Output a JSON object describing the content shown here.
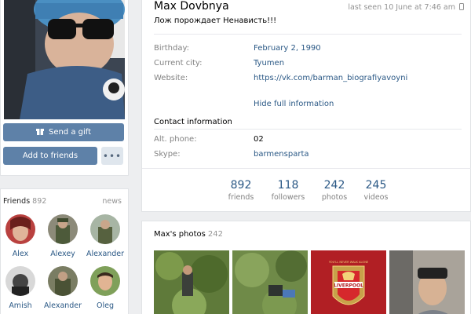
{
  "left": {
    "send_gift": "Send a gift",
    "add_friends": "Add to friends",
    "more": "•••"
  },
  "friends": {
    "title": "Friends",
    "count": "892",
    "news": "news",
    "items": [
      {
        "name": "Alex"
      },
      {
        "name": "Alexey"
      },
      {
        "name": "Alexander"
      },
      {
        "name": "Amish"
      },
      {
        "name": "Alexander"
      },
      {
        "name": "Oleg"
      }
    ]
  },
  "profile": {
    "name": "Max Dovbnya",
    "last_seen": "last seen 10 June at 7:46 am",
    "status": "Лож порождает Ненависть!!!",
    "info": [
      {
        "label": "Birthday:",
        "value": "February 2, 1990"
      },
      {
        "label": "Current city:",
        "value": "Tyumen"
      },
      {
        "label": "Website:",
        "value": "https://vk.com/barman_biografiyavoyni"
      }
    ],
    "hide_link": "Hide full information",
    "contact_title": "Contact information",
    "contacts": [
      {
        "label": "Alt. phone:",
        "value": "02"
      },
      {
        "label": "Skype:",
        "value": "barmensparta"
      }
    ],
    "stats": [
      {
        "num": "892",
        "label": "friends"
      },
      {
        "num": "118",
        "label": "followers"
      },
      {
        "num": "242",
        "label": "photos"
      },
      {
        "num": "245",
        "label": "videos"
      }
    ]
  },
  "photos": {
    "title": "Max's photos",
    "count": "242",
    "badge_text": "LIVERPOOL",
    "badge_subtext": "YOU'LL NEVER WALK ALONE"
  },
  "colors": {
    "accent": "#5e81a8",
    "link": "#2a5885",
    "muted": "#828282",
    "page_bg": "#edeef0"
  }
}
